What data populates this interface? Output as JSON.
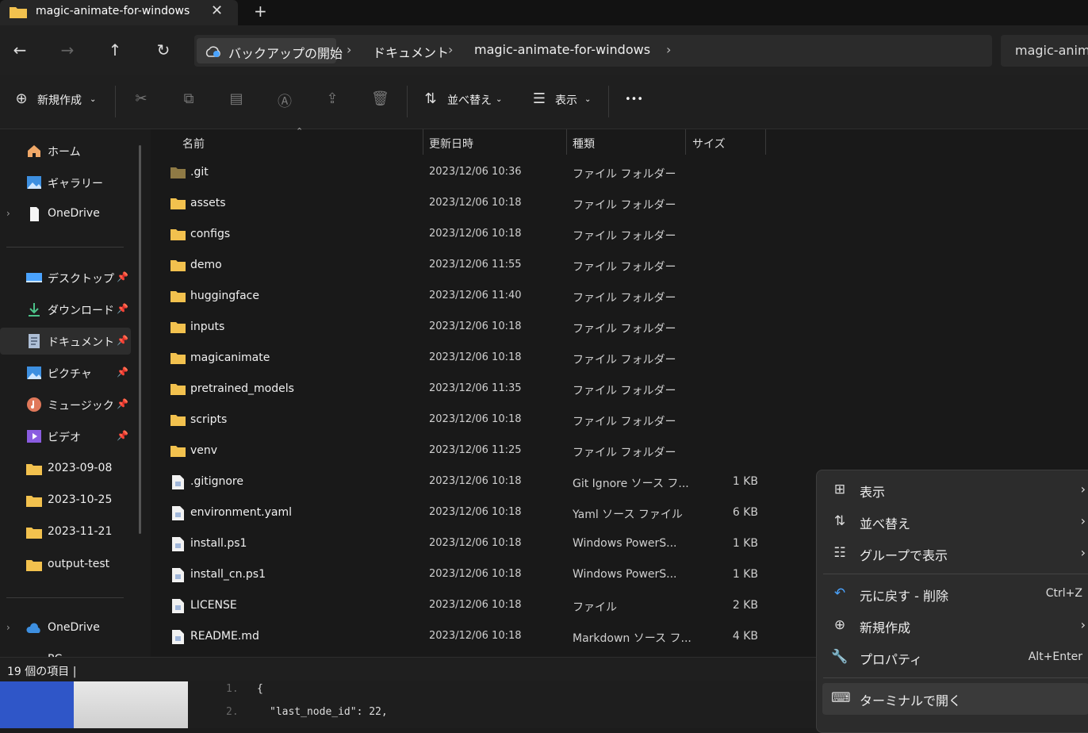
{
  "tab": {
    "title": "magic-animate-for-windows",
    "close": "✕",
    "new": "+"
  },
  "address": {
    "crumbs": [
      "バックアップの開始",
      "ドキュメント",
      "magic-animate-for-windows"
    ],
    "search_text": "magic-anim"
  },
  "toolbar": {
    "new_label": "新規作成",
    "sort_label": "並べ替え",
    "view_label": "表示",
    "more": "•••"
  },
  "sidebar": {
    "home": "ホーム",
    "gallery": "ギャラリー",
    "onedrive": "OneDrive",
    "desktop": "デスクトップ",
    "downloads": "ダウンロード",
    "documents": "ドキュメント",
    "pictures": "ピクチャ",
    "music": "ミュージック",
    "videos": "ビデオ",
    "f1": "2023-09-08",
    "f2": "2023-10-25",
    "f3": "2023-11-21",
    "f4": "output-test",
    "onedrive2": "OneDrive",
    "pc": "PC"
  },
  "columns": {
    "name": "名前",
    "date": "更新日時",
    "type": "種類",
    "size": "サイズ"
  },
  "files": [
    {
      "name": ".git",
      "date": "2023/12/06 10:36",
      "type": "ファイル フォルダー",
      "size": ""
    },
    {
      "name": "assets",
      "date": "2023/12/06 10:18",
      "type": "ファイル フォルダー",
      "size": ""
    },
    {
      "name": "configs",
      "date": "2023/12/06 10:18",
      "type": "ファイル フォルダー",
      "size": ""
    },
    {
      "name": "demo",
      "date": "2023/12/06 11:55",
      "type": "ファイル フォルダー",
      "size": ""
    },
    {
      "name": "huggingface",
      "date": "2023/12/06 11:40",
      "type": "ファイル フォルダー",
      "size": ""
    },
    {
      "name": "inputs",
      "date": "2023/12/06 10:18",
      "type": "ファイル フォルダー",
      "size": ""
    },
    {
      "name": "magicanimate",
      "date": "2023/12/06 10:18",
      "type": "ファイル フォルダー",
      "size": ""
    },
    {
      "name": "pretrained_models",
      "date": "2023/12/06 11:35",
      "type": "ファイル フォルダー",
      "size": ""
    },
    {
      "name": "scripts",
      "date": "2023/12/06 10:18",
      "type": "ファイル フォルダー",
      "size": ""
    },
    {
      "name": "venv",
      "date": "2023/12/06 11:25",
      "type": "ファイル フォルダー",
      "size": ""
    },
    {
      "name": ".gitignore",
      "date": "2023/12/06 10:18",
      "type": "Git Ignore ソース フ...",
      "size": "1 KB"
    },
    {
      "name": "environment.yaml",
      "date": "2023/12/06 10:18",
      "type": "Yaml ソース ファイル",
      "size": "6 KB"
    },
    {
      "name": "install.ps1",
      "date": "2023/12/06 10:18",
      "type": "Windows PowerS...",
      "size": "1 KB"
    },
    {
      "name": "install_cn.ps1",
      "date": "2023/12/06 10:18",
      "type": "Windows PowerS...",
      "size": "1 KB"
    },
    {
      "name": "LICENSE",
      "date": "2023/12/06 10:18",
      "type": "ファイル",
      "size": "2 KB"
    },
    {
      "name": "README.md",
      "date": "2023/12/06 10:18",
      "type": "Markdown ソース フ...",
      "size": "4 KB"
    }
  ],
  "status": {
    "count": "19 個の項目  |"
  },
  "editor": {
    "line1": "1.",
    "line2": "2.",
    "code1": "{",
    "code2": "\"last_node_id\": 22,"
  },
  "context_menu": {
    "view": "表示",
    "sort": "並べ替え",
    "group": "グループで表示",
    "undo": "元に戻す - 削除",
    "undo_key": "Ctrl+Z",
    "new": "新規作成",
    "props": "プロパティ",
    "props_key": "Alt+Enter",
    "terminal": "ターミナルで開く"
  },
  "colors": {
    "folder": "#f2c14e",
    "accent": "#4aa3ff"
  }
}
